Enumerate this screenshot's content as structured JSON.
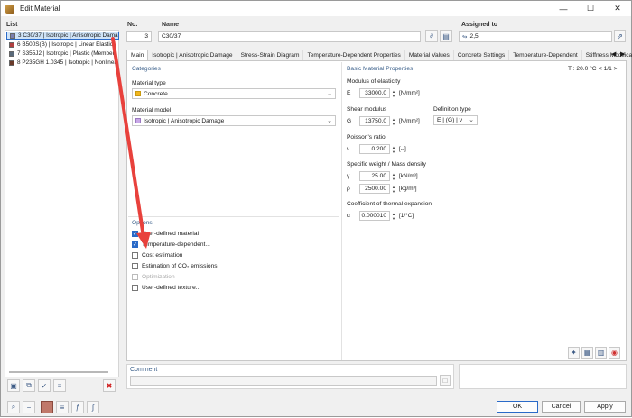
{
  "window": {
    "title": "Edit Material",
    "controls": [
      "minimize",
      "maximize",
      "close"
    ]
  },
  "list": {
    "header": "List",
    "items": [
      {
        "label": "3  C30/37 | Isotropic | Anisotropic Dama",
        "color": "#7a7fb0",
        "selected": true
      },
      {
        "label": "6  B500S(B) | Isotropic | Linear Elastic",
        "color": "#b04040",
        "selected": false
      },
      {
        "label": "7  S355J2 | Isotropic | Plastic (Member",
        "color": "#5a6a7a",
        "selected": false
      },
      {
        "label": "8  P235GH 1.0345 | Isotropic | Nonlinea",
        "color": "#6a3a2a",
        "selected": false
      }
    ]
  },
  "no": {
    "header": "No.",
    "value": "3"
  },
  "name": {
    "header": "Name",
    "value": "C30/37"
  },
  "assigned": {
    "header": "Assigned to",
    "value": "2,5"
  },
  "tabs": [
    "Main",
    "Isotropic | Anisotropic Damage",
    "Stress-Strain Diagram",
    "Temperature-Dependent Properties",
    "Material Values",
    "Concrete Settings",
    "Temperature-Dependent",
    "Stiffness Modification"
  ],
  "categories": {
    "header": "Categories",
    "material_type_label": "Material type",
    "material_type_value": "Concrete",
    "material_type_color": "#f2b61d",
    "material_model_label": "Material model",
    "material_model_value": "Isotropic | Anisotropic Damage",
    "material_model_color": "#c9a8e8"
  },
  "options": {
    "header": "Options",
    "items": [
      {
        "label": "User-defined material",
        "checked": true,
        "disabled": false
      },
      {
        "label": "Temperature-dependent...",
        "checked": true,
        "disabled": false
      },
      {
        "label": "Cost estimation",
        "checked": false,
        "disabled": false
      },
      {
        "label": "Estimation of CO₂ emissions",
        "checked": false,
        "disabled": false
      },
      {
        "label": "Optimization",
        "checked": false,
        "disabled": true
      },
      {
        "label": "User-defined texture...",
        "checked": false,
        "disabled": false
      }
    ]
  },
  "basic": {
    "header": "Basic Material Properties",
    "temperature": "T : 20.0 °C",
    "pager": "< 1/1 >",
    "elasticity_label": "Modulus of elasticity",
    "E_symbol": "E",
    "E_value": "33000.0",
    "E_unit": "[N/mm²]",
    "shear_label": "Shear modulus",
    "G_symbol": "G",
    "G_value": "13750.0",
    "G_unit": "[N/mm²]",
    "def_type_label": "Definition type",
    "def_type_value": "E | (G) | ν",
    "poisson_label": "Poisson's ratio",
    "nu_symbol": "ν",
    "nu_value": "0.200",
    "nu_unit": "[--]",
    "weight_label": "Specific weight / Mass density",
    "gamma_symbol": "γ",
    "gamma_value": "25.00",
    "gamma_unit": "[kN/m³]",
    "rho_symbol": "ρ",
    "rho_value": "2500.00",
    "rho_unit": "[kg/m³]",
    "thermal_label": "Coefficient of thermal expansion",
    "alpha_symbol": "α",
    "alpha_value": "0.000010",
    "alpha_unit": "[1/°C]"
  },
  "comment": {
    "header": "Comment",
    "value": ""
  },
  "buttons": {
    "ok": "OK",
    "cancel": "Cancel",
    "apply": "Apply"
  },
  "arrow_color": "#e8413c"
}
